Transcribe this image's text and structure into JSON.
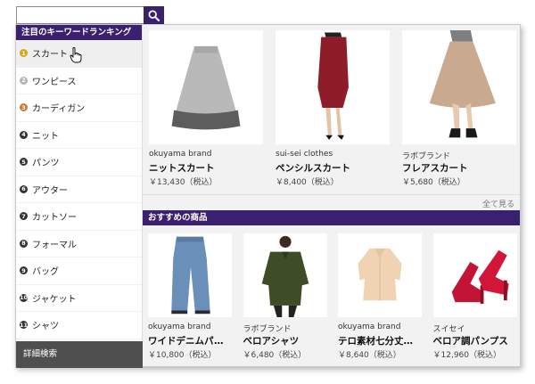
{
  "search": {
    "value": "",
    "placeholder": ""
  },
  "sidebar": {
    "heading": "注目のキーワードランキング",
    "items": [
      {
        "rank": "1",
        "label": "スカート",
        "tier": "gold",
        "active": true
      },
      {
        "rank": "2",
        "label": "ワンピース",
        "tier": "silver",
        "active": false
      },
      {
        "rank": "3",
        "label": "カーディガン",
        "tier": "bronze",
        "active": false
      },
      {
        "rank": "4",
        "label": "ニット",
        "tier": "plain",
        "active": false
      },
      {
        "rank": "5",
        "label": "パンツ",
        "tier": "plain",
        "active": false
      },
      {
        "rank": "6",
        "label": "アウター",
        "tier": "plain",
        "active": false
      },
      {
        "rank": "7",
        "label": "カットソー",
        "tier": "plain",
        "active": false
      },
      {
        "rank": "8",
        "label": "フォーマル",
        "tier": "plain",
        "active": false
      },
      {
        "rank": "9",
        "label": "バッグ",
        "tier": "plain",
        "active": false
      },
      {
        "rank": "10",
        "label": "ジャケット",
        "tier": "plain",
        "active": false
      },
      {
        "rank": "11",
        "label": "シャツ",
        "tier": "plain",
        "active": false
      }
    ],
    "detail_button": "詳細検索"
  },
  "keyword_products": [
    {
      "brand": "okuyama brand",
      "name": "ニットスカート",
      "price": "￥13,430（税込）",
      "image": "grey-knit-skirt"
    },
    {
      "brand": "sui-sei clothes",
      "name": "ペンシルスカート",
      "price": "￥8,400（税込）",
      "image": "red-pencil-skirt"
    },
    {
      "brand": "ラボブランド",
      "name": "フレアスカート",
      "price": "￥5,680（税込）",
      "image": "beige-flare-skirt"
    }
  ],
  "see_all": "全て見る",
  "recommend": {
    "heading": "おすすめの商品",
    "products": [
      {
        "brand": "okuyama brand",
        "name": "ワイドデニムパンツ",
        "price": "￥10,800（税込）",
        "image": "wide-denim-pants"
      },
      {
        "brand": "ラボブランド",
        "name": "ベロアシャツ",
        "price": "￥6,480（税込）",
        "image": "olive-velour-shirt"
      },
      {
        "brand": "okuyama brand",
        "name": "テロ素材七分丈シ…",
        "price": "￥8,640（税込）",
        "image": "beige-blouse"
      },
      {
        "brand": "スイセイ",
        "name": "ベロア調パンプス",
        "price": "￥12,960（税込）",
        "image": "red-velour-pumps"
      }
    ]
  },
  "colors": {
    "accent": "#3a2170",
    "sidebar_footer": "#4f4f4f",
    "panel_bg": "#f2f2f2"
  }
}
